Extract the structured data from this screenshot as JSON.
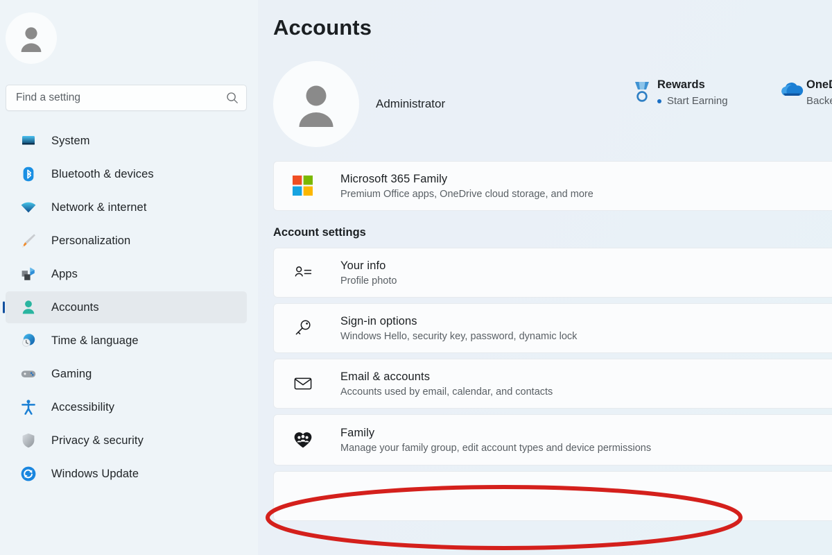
{
  "sidebar": {
    "avatar_icon": "person-avatar-icon",
    "search": {
      "placeholder": "Find a setting",
      "value": "",
      "icon": "search-icon"
    },
    "items": [
      {
        "label": "System",
        "icon": "monitor-icon",
        "selected": false
      },
      {
        "label": "Bluetooth & devices",
        "icon": "bluetooth-icon",
        "selected": false
      },
      {
        "label": "Network & internet",
        "icon": "wifi-icon",
        "selected": false
      },
      {
        "label": "Personalization",
        "icon": "brush-icon",
        "selected": false
      },
      {
        "label": "Apps",
        "icon": "apps-icon",
        "selected": false
      },
      {
        "label": "Accounts",
        "icon": "account-icon",
        "selected": true
      },
      {
        "label": "Time & language",
        "icon": "clock-icon",
        "selected": false
      },
      {
        "label": "Gaming",
        "icon": "gamepad-icon",
        "selected": false
      },
      {
        "label": "Accessibility",
        "icon": "accessibility-icon",
        "selected": false
      },
      {
        "label": "Privacy & security",
        "icon": "shield-icon",
        "selected": false
      },
      {
        "label": "Windows Update",
        "icon": "update-icon",
        "selected": false
      }
    ]
  },
  "main": {
    "page_title": "Accounts",
    "profile": {
      "avatar_icon": "person-avatar-icon",
      "name": "Administrator"
    },
    "tiles": [
      {
        "icon": "rewards-medal-icon",
        "title": "Rewards",
        "subtitle": "Start Earning",
        "has_bullet": true
      },
      {
        "icon": "onedrive-cloud-icon",
        "title": "OneDrive",
        "subtitle": "Backed up",
        "has_bullet": false
      }
    ],
    "subscription_card": {
      "icon": "microsoft-logo-icon",
      "title": "Microsoft 365 Family",
      "subtitle": "Premium Office apps, OneDrive cloud storage, and more",
      "chevron": "chevron-right-icon"
    },
    "section_heading": "Account settings",
    "settings_cards": [
      {
        "icon": "your-info-icon",
        "title": "Your info",
        "subtitle": "Profile photo",
        "chevron": "chevron-right-icon",
        "highlighted": false
      },
      {
        "icon": "key-icon",
        "title": "Sign-in options",
        "subtitle": "Windows Hello, security key, password, dynamic lock",
        "chevron": "chevron-right-icon",
        "highlighted": false
      },
      {
        "icon": "envelope-icon",
        "title": "Email & accounts",
        "subtitle": "Accounts used by email, calendar, and contacts",
        "chevron": "chevron-right-icon",
        "highlighted": false
      },
      {
        "icon": "family-heart-icon",
        "title": "Family",
        "subtitle": "Manage your family group, edit account types and device permissions",
        "chevron": "chevron-right-icon",
        "highlighted": true
      }
    ]
  },
  "annotation": {
    "type": "ellipse-highlight",
    "target": "Family",
    "color": "#d4201c",
    "stroke_width": 6
  },
  "colors": {
    "accent_bar": "#12509e",
    "sidebar_bg": "#eef4f8",
    "card_bg": "#fbfcfd",
    "page_bg": "#eaf0f6",
    "highlight_red": "#d4201c",
    "text_primary": "#1b1f22",
    "text_secondary": "#5a6065"
  }
}
